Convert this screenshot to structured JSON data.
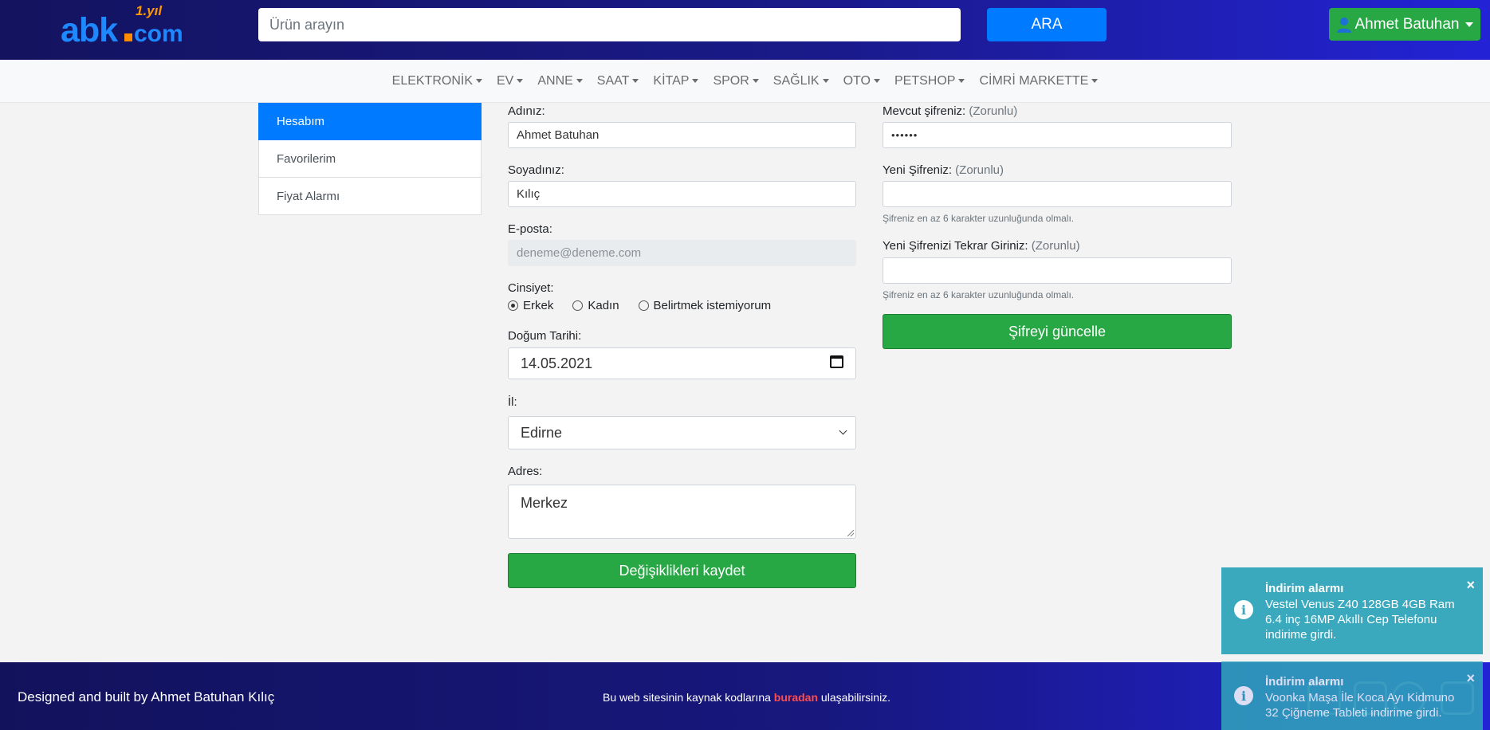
{
  "header": {
    "logo_text": "abk",
    "logo_suffix": "com",
    "logo_badge": "1.yıl",
    "search_placeholder": "Ürün arayın",
    "search_button": "ARA",
    "user_name": "Ahmet Batuhan"
  },
  "categories": [
    "ELEKTRONİK",
    "EV",
    "ANNE",
    "SAAT",
    "KİTAP",
    "SPOR",
    "SAĞLIK",
    "OTO",
    "PETSHOP",
    "CİMRİ MARKETTE"
  ],
  "sidebar": {
    "items": [
      {
        "label": "Hesabım",
        "active": true
      },
      {
        "label": "Favorilerim",
        "active": false
      },
      {
        "label": "Fiyat Alarmı",
        "active": false
      }
    ]
  },
  "profile_form": {
    "first_name_label": "Adınız:",
    "first_name_value": "Ahmet Batuhan",
    "last_name_label": "Soyadınız:",
    "last_name_value": "Kılıç",
    "email_label": "E-posta:",
    "email_value": "deneme@deneme.com",
    "gender_label": "Cinsiyet:",
    "gender_options": [
      "Erkek",
      "Kadın",
      "Belirtmek istemiyorum"
    ],
    "gender_selected": "Erkek",
    "birthdate_label": "Doğum Tarihi:",
    "birthdate_value": "14.05.2021",
    "city_label": "İl:",
    "city_value": "Edirne",
    "address_label": "Adres:",
    "address_value": "Merkez",
    "save_button": "Değişiklikleri kaydet"
  },
  "password_form": {
    "current_label": "Mevcut şifreniz:",
    "required_text": "(Zorunlu)",
    "current_value": "••••••",
    "new_label": "Yeni Şifreniz:",
    "new_help": "Şifreniz en az 6 karakter uzunluğunda olmalı.",
    "repeat_label": "Yeni Şifrenizi Tekrar Giriniz:",
    "repeat_help": "Şifreniz en az 6 karakter uzunluğunda olmalı.",
    "update_button": "Şifreyi güncelle"
  },
  "footer": {
    "credit": "Designed and built by Ahmet Batuhan Kılıç",
    "source_prefix": "Bu web sitesinin kaynak kodlarına ",
    "source_link": "buradan",
    "source_suffix": " ulaşabilirsiniz."
  },
  "toasts": [
    {
      "title": "İndirim alarmı",
      "message": "Vestel Venus Z40 128GB 4GB Ram 6.4 inç 16MP Akıllı Cep Telefonu indirime girdi.",
      "icon": "info-icon",
      "close": "×"
    },
    {
      "title": "İndirim alarmı",
      "message": "Voonka Maşa İle Koca Ayı Kidmuno 32 Çiğneme Tableti indirime girdi.",
      "icon": "info-icon",
      "close": "×"
    }
  ],
  "colors": {
    "primary": "#007bff",
    "success": "#28a745",
    "info": "#31a6bc",
    "header_dark": "#13135f",
    "header_light": "#2323d6"
  }
}
